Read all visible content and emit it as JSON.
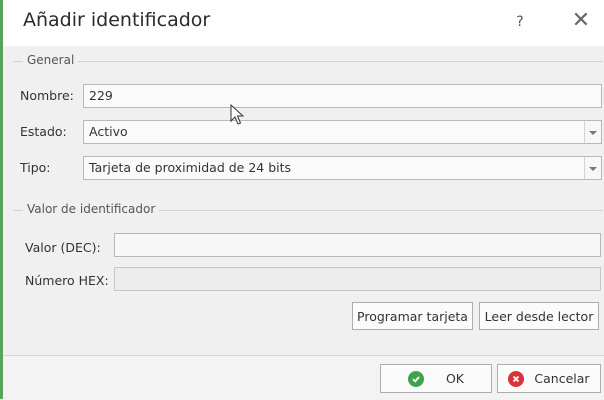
{
  "dialog": {
    "title": "Añadir identificador",
    "help_label": "?",
    "close_label": "✕"
  },
  "general": {
    "legend": "General",
    "nombre_label": "Nombre:",
    "nombre_value": "229",
    "estado_label": "Estado:",
    "estado_value": "Activo",
    "tipo_label": "Tipo:",
    "tipo_value": "Tarjeta de proximidad de 24 bits"
  },
  "valor": {
    "legend": "Valor de identificador",
    "dec_label": "Valor (DEC):",
    "dec_value": "",
    "hex_label": "Número HEX:",
    "hex_value": "",
    "program_button": "Programar tarjeta",
    "read_button": "Leer desde lector"
  },
  "footer": {
    "ok_label": "OK",
    "cancel_label": "Cancelar"
  },
  "icons": {
    "ok": "check-circle-icon",
    "cancel": "x-circle-icon",
    "cursor": "mouse-pointer-icon"
  },
  "colors": {
    "accent_border": "#5aa35a",
    "ok_icon": "#3fa34d",
    "cancel_icon": "#d9343a"
  }
}
